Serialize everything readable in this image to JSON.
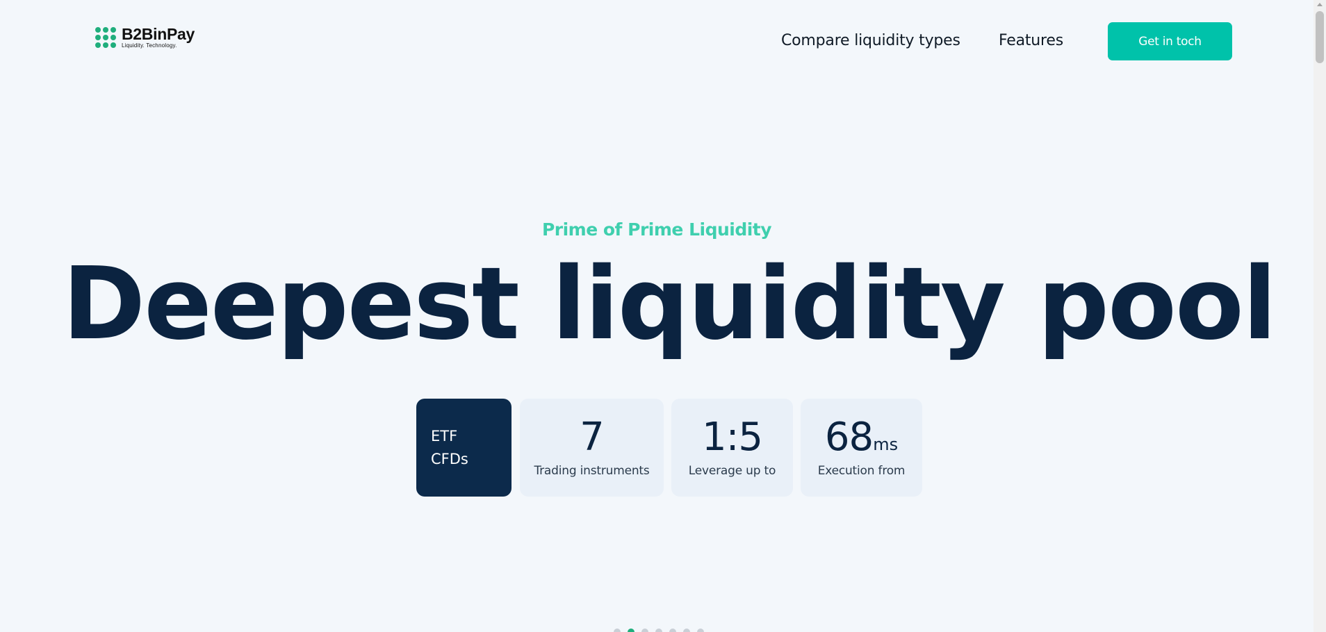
{
  "header": {
    "logo_name": "B2BinPay",
    "logo_tagline": "Liquidity. Technology.",
    "nav": [
      "Compare liquidity types",
      "Features"
    ],
    "cta_label": "Get in toch"
  },
  "hero": {
    "eyebrow": "Prime of Prime Liquidity",
    "headline": "Deepest liquidity pool",
    "category_lines": [
      "ETF",
      "CFDs"
    ],
    "stats": [
      {
        "value": "7",
        "unit": "",
        "label": "Trading instruments"
      },
      {
        "value": "1:5",
        "unit": "",
        "label": "Leverage up to"
      },
      {
        "value": "68",
        "unit": "ms",
        "label": "Execution from"
      }
    ]
  },
  "carousel": {
    "slide_count": 7,
    "active_slide": 2
  },
  "colors": {
    "accent": "#00c2aa",
    "brand_green": "#1fae7c",
    "navy": "#0b2340",
    "background": "#f3f7fb"
  }
}
